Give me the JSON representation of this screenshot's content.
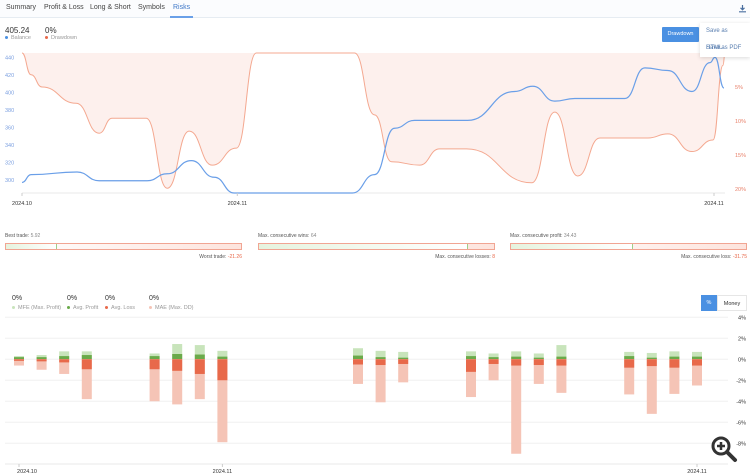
{
  "tabs": [
    {
      "label": "Summary"
    },
    {
      "label": "Profit & Loss"
    },
    {
      "label": "Long & Short"
    },
    {
      "label": "Symbols"
    },
    {
      "label": "Risks",
      "active": true
    }
  ],
  "download_icon": "download-icon",
  "summary": {
    "balance": {
      "value": "405.24",
      "label": "Balance",
      "color": "#4a90e2"
    },
    "drawdown": {
      "value": "0%",
      "label": "Drawdown",
      "color": "#e8694a"
    }
  },
  "drawdown_button": "Drawdown",
  "export_menu": [
    "Save as HTML",
    "Save as PDF"
  ],
  "chart_data": [
    {
      "type": "line",
      "title": "",
      "xlabel": "",
      "ylabel": "",
      "x_ticks": [
        {
          "x": 0,
          "label": "2024.10"
        },
        {
          "x": 21.5,
          "label": "2024.11"
        },
        {
          "x": 69.1,
          "label": "2024.11"
        }
      ],
      "xlim": [
        0,
        70.2
      ],
      "left_axis": {
        "ylim": [
          285,
          445
        ],
        "ticks": [
          300,
          320,
          340,
          360,
          380,
          400,
          420,
          440
        ],
        "color": "#7a9fe0"
      },
      "right_axis": {
        "ylim": [
          0,
          20.6
        ],
        "ticks": [
          {
            "v": 5,
            "label": "5%"
          },
          {
            "v": 10,
            "label": "10%"
          },
          {
            "v": 15,
            "label": "15%"
          },
          {
            "v": 20,
            "label": "20%"
          }
        ],
        "color": "#e8806a",
        "inverted": true
      },
      "series": [
        {
          "name": "Balance",
          "axis": "left",
          "color": "#6a9fe8",
          "points": [
            [
              0,
              297
            ],
            [
              0.9,
              306
            ],
            [
              5.5,
              309
            ],
            [
              7.7,
              299
            ],
            [
              12.5,
              299
            ],
            [
              14.5,
              307
            ],
            [
              16.9,
              322
            ],
            [
              19.2,
              303
            ],
            [
              21.2,
              285
            ],
            [
              33,
              285
            ],
            [
              35.2,
              306
            ],
            [
              37.2,
              359
            ],
            [
              39.2,
              368
            ],
            [
              44.5,
              368
            ],
            [
              49.2,
              401
            ],
            [
              51,
              407
            ],
            [
              53.2,
              390
            ],
            [
              55.2,
              393
            ],
            [
              60.2,
              393
            ],
            [
              62.2,
              428
            ],
            [
              64.5,
              425
            ],
            [
              66.9,
              401
            ],
            [
              68.7,
              434
            ],
            [
              69.2,
              440
            ],
            [
              70.1,
              405
            ]
          ]
        },
        {
          "name": "Drawdown",
          "axis": "right",
          "color": "#f4a890",
          "fill": "#fdf0ed",
          "points": [
            [
              0,
              0
            ],
            [
              0.9,
              3.2
            ],
            [
              2,
              5
            ],
            [
              5.4,
              7.4
            ],
            [
              7.7,
              11.8
            ],
            [
              9,
              9.6
            ],
            [
              12.4,
              9.6
            ],
            [
              14.5,
              19.9
            ],
            [
              16.7,
              11.5
            ],
            [
              19,
              16.5
            ],
            [
              21.4,
              14
            ],
            [
              23.4,
              0
            ],
            [
              33.2,
              0
            ],
            [
              35.2,
              9.1
            ],
            [
              36.9,
              16
            ],
            [
              39.7,
              16.5
            ],
            [
              41.7,
              14.1
            ],
            [
              44.4,
              14.1
            ],
            [
              50.9,
              19.1
            ],
            [
              53.2,
              8.7
            ],
            [
              55.5,
              18.1
            ],
            [
              57.7,
              12.5
            ],
            [
              62.5,
              12.5
            ],
            [
              64.5,
              11.9
            ],
            [
              66.9,
              14.5
            ],
            [
              69,
              12.8
            ],
            [
              70,
              1.8
            ],
            [
              70.2,
              0
            ]
          ]
        }
      ]
    },
    {
      "type": "bar",
      "title": "",
      "xlabel": "",
      "ylabel": "",
      "ylim": [
        -9.5,
        4.5
      ],
      "y_ticks": [
        {
          "v": 4,
          "label": "4%"
        },
        {
          "v": 2,
          "label": "2%"
        },
        {
          "v": 0,
          "label": "0%"
        },
        {
          "v": -2,
          "label": "-2%"
        },
        {
          "v": -4,
          "label": "-4%"
        },
        {
          "v": -6,
          "label": "-6%"
        },
        {
          "v": -8,
          "label": "-8%"
        }
      ],
      "x_ticks": [
        {
          "date": "2024-10-22",
          "label": "2024.10"
        },
        {
          "date": "2024-10-31",
          "label": "2024.11"
        },
        {
          "date": "2024-11-21",
          "label": "2024.11"
        }
      ],
      "series_colors": {
        "mfe": "#c8e4bb",
        "avg_profit": "#6aaa4a",
        "avg_loss": "#e8694a",
        "mae": "#f5c4b6"
      },
      "bars": [
        {
          "date": "2024-10-22",
          "mfe": 0.3,
          "avg_profit": 0.2,
          "avg_loss": -0.15,
          "mae": -0.6
        },
        {
          "date": "2024-10-23",
          "mfe": 0.4,
          "avg_profit": 0.2,
          "avg_loss": -0.2,
          "mae": -1.0
        },
        {
          "date": "2024-10-24",
          "mfe": 0.75,
          "avg_profit": 0.3,
          "avg_loss": -0.3,
          "mae": -1.4
        },
        {
          "date": "2024-10-25",
          "mfe": 0.75,
          "avg_profit": 0.4,
          "avg_loss": -0.95,
          "mae": -3.8
        },
        {
          "date": "2024-10-28",
          "mfe": 0.55,
          "avg_profit": 0.3,
          "avg_loss": -0.95,
          "mae": -4.0
        },
        {
          "date": "2024-10-29",
          "mfe": 1.45,
          "avg_profit": 0.5,
          "avg_loss": -1.1,
          "mae": -4.3
        },
        {
          "date": "2024-10-30",
          "mfe": 1.35,
          "avg_profit": 0.45,
          "avg_loss": -1.4,
          "mae": -3.8
        },
        {
          "date": "2024-10-31",
          "mfe": 0.8,
          "avg_profit": 0.25,
          "avg_loss": -2.0,
          "mae": -7.9
        },
        {
          "date": "2024-11-06",
          "mfe": 1.05,
          "avg_profit": 0.35,
          "avg_loss": -0.5,
          "mae": -2.35
        },
        {
          "date": "2024-11-07",
          "mfe": 0.8,
          "avg_profit": 0.2,
          "avg_loss": -0.55,
          "mae": -4.1
        },
        {
          "date": "2024-11-08",
          "mfe": 0.7,
          "avg_profit": 0.15,
          "avg_loss": -0.45,
          "mae": -2.2
        },
        {
          "date": "2024-11-11",
          "mfe": 0.75,
          "avg_profit": 0.3,
          "avg_loss": -1.2,
          "mae": -3.6
        },
        {
          "date": "2024-11-12",
          "mfe": 0.55,
          "avg_profit": 0.2,
          "avg_loss": -0.45,
          "mae": -2.0
        },
        {
          "date": "2024-11-13",
          "mfe": 0.75,
          "avg_profit": 0.25,
          "avg_loss": -0.6,
          "mae": -9.0
        },
        {
          "date": "2024-11-14",
          "mfe": 0.55,
          "avg_profit": 0.15,
          "avg_loss": -0.55,
          "mae": -2.35
        },
        {
          "date": "2024-11-15",
          "mfe": 1.35,
          "avg_profit": 0.25,
          "avg_loss": -0.6,
          "mae": -3.2
        },
        {
          "date": "2024-11-18",
          "mfe": 0.7,
          "avg_profit": 0.3,
          "avg_loss": -0.8,
          "mae": -3.35
        },
        {
          "date": "2024-11-19",
          "mfe": 0.6,
          "avg_profit": 0.15,
          "avg_loss": -0.65,
          "mae": -5.2
        },
        {
          "date": "2024-11-20",
          "mfe": 0.75,
          "avg_profit": 0.25,
          "avg_loss": -0.8,
          "mae": -3.3
        },
        {
          "date": "2024-11-21",
          "mfe": 0.7,
          "avg_profit": 0.25,
          "avg_loss": -0.6,
          "mae": -2.5
        }
      ]
    }
  ],
  "stats": [
    {
      "top_label": "Best trade:",
      "top_value": "5.92",
      "top_num": 5.92,
      "bottom_label": "Worst trade:",
      "bottom_value": "-21.26",
      "bottom_num": 21.26
    },
    {
      "top_label": "Max. consecutive wins:",
      "top_value": "64",
      "top_num": 64,
      "bottom_label": "Max. consecutive losses:",
      "bottom_value": "8",
      "bottom_num": 8
    },
    {
      "top_label": "Max. consecutive profit:",
      "top_value": "34.43",
      "top_num": 34.43,
      "bottom_label": "Max. consecutive loss:",
      "bottom_value": "-31.75",
      "bottom_num": 31.75
    }
  ],
  "mfe_legend": [
    {
      "value": "0%",
      "label": "MFE (Max. Profit)",
      "color": "#c8e4bb"
    },
    {
      "value": "0%",
      "label": "Avg. Profit",
      "color": "#6aaa4a"
    },
    {
      "value": "0%",
      "label": "Avg. Loss",
      "color": "#e8694a"
    },
    {
      "value": "0%",
      "label": "MAE (Max. DD)",
      "color": "#f5c4b6"
    }
  ],
  "toggle": {
    "percent": "%",
    "money": "Money",
    "selected": "%"
  },
  "zoom_icon": "zoom-in-icon"
}
